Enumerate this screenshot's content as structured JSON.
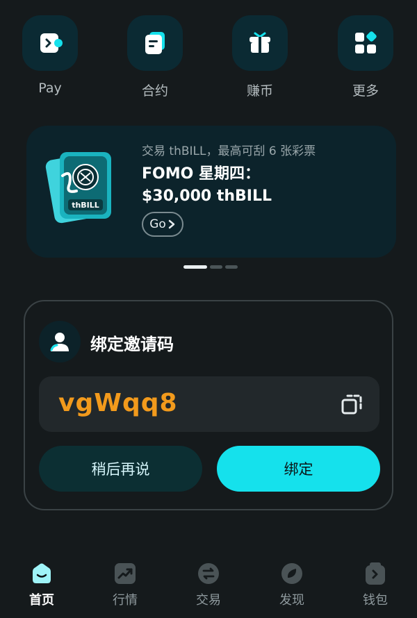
{
  "quick_actions": [
    {
      "label": "Pay",
      "icon": "pay-wallet-icon"
    },
    {
      "label": "合约",
      "icon": "contract-card-icon"
    },
    {
      "label": "赚币",
      "icon": "gift-box-icon"
    },
    {
      "label": "更多",
      "icon": "grid-more-icon"
    }
  ],
  "banner": {
    "subtitle": "交易 thBILL，最高可刮 6 张彩票",
    "title_line1": "FOMO 星期四：",
    "title_line2": "$30,000 thBILL",
    "ticket_text": "thBILL",
    "go_label": "Go",
    "page_count": 3,
    "active_page": 1
  },
  "invite": {
    "title": "绑定邀请码",
    "code": "vgWqq8",
    "later_label": "稍后再说",
    "bind_label": "绑定"
  },
  "tabs": [
    {
      "label": "首页",
      "icon": "home-icon",
      "active": true
    },
    {
      "label": "行情",
      "icon": "market-chart-icon",
      "active": false
    },
    {
      "label": "交易",
      "icon": "trade-swap-icon",
      "active": false
    },
    {
      "label": "发现",
      "icon": "discover-leaf-icon",
      "active": false
    },
    {
      "label": "钱包",
      "icon": "wallet-icon",
      "active": false
    }
  ],
  "colors": {
    "background": "#151a1c",
    "accent": "#15e1ec",
    "code": "#f29a1c",
    "tile": "#0b2a33"
  }
}
